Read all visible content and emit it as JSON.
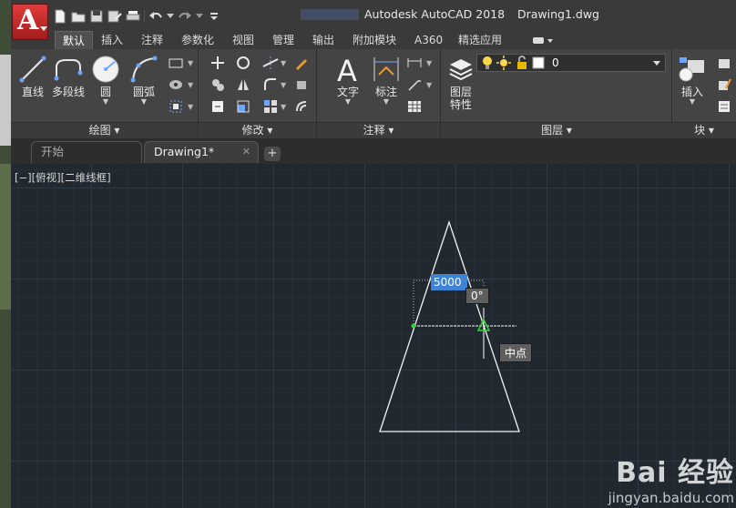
{
  "app": {
    "title": "Autodesk AutoCAD 2018",
    "document": "Drawing1.dwg",
    "app_button_letter": "A",
    "brand_color": "#c62828"
  },
  "ribbon_tabs": [
    "默认",
    "插入",
    "注释",
    "参数化",
    "视图",
    "管理",
    "输出",
    "附加模块",
    "A360",
    "精选应用"
  ],
  "ribbon": {
    "draw": {
      "title": "绘图",
      "tools": [
        "直线",
        "多段线",
        "圆",
        "圆弧"
      ]
    },
    "modify": {
      "title": "修改"
    },
    "annotation": {
      "title": "注释",
      "tools": [
        "文字",
        "标注"
      ]
    },
    "layers": {
      "title": "图层",
      "tools": [
        "图层",
        "特性"
      ],
      "current_layer": "0"
    },
    "block": {
      "title": "块",
      "tools": [
        "插入"
      ]
    }
  },
  "file_tabs": [
    {
      "label": "开始",
      "active": false
    },
    {
      "label": "Drawing1*",
      "active": true
    }
  ],
  "canvas": {
    "viewport_label": "[−][俯视][二维线框]",
    "dynamic_input_value": "5000",
    "angle_tooltip": "0°",
    "snap_tooltip": "中点"
  },
  "watermark": {
    "brand": "Bai 经验",
    "url": "jingyan.baidu.com"
  }
}
